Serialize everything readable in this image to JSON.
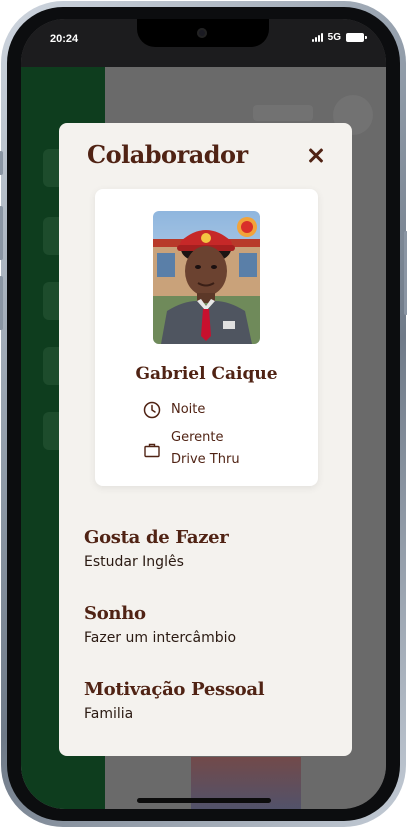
{
  "status_bar": {
    "time": "20:24",
    "network": "5G"
  },
  "modal": {
    "title": "Colaborador",
    "close_icon": "close-icon"
  },
  "employee": {
    "name": "Gabriel Caique",
    "shift": "Noite",
    "role_line1": "Gerente",
    "role_line2": "Drive Thru",
    "shift_icon": "clock-icon",
    "role_icon": "briefcase-icon"
  },
  "sections": [
    {
      "title": "Gosta de Fazer",
      "text": "Estudar Inglês"
    },
    {
      "title": "Sonho",
      "text": "Fazer um intercâmbio"
    },
    {
      "title": "Motivação Pessoal",
      "text": "Familia"
    }
  ],
  "colors": {
    "brand_brown": "#502314",
    "modal_bg": "#f4f2ee",
    "sidebar_green": "#0e3d1e"
  }
}
